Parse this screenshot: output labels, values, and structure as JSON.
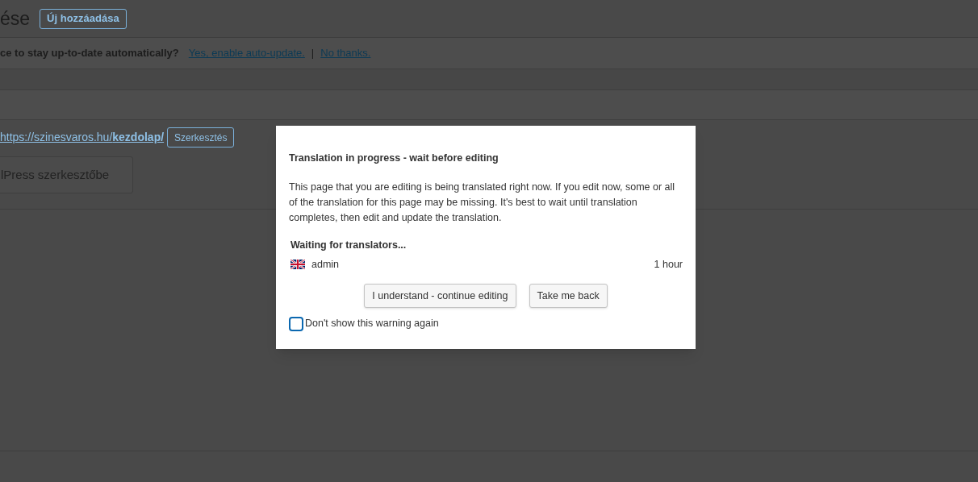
{
  "page": {
    "title": "ése",
    "add_new_button": "Új hozzáadása",
    "notice": {
      "text": "ce to stay up-to-date automatically?",
      "links": [
        "Yes, enable auto-update.",
        "No thanks."
      ],
      "separator": "|"
    },
    "permalink": {
      "url": "https://szinesvaros.hu/**kezdolap/**",
      "edit_button": "Szerkesztés"
    },
    "editor_button": "lPress szerkesztőbe"
  },
  "dialog": {
    "title": "Translation in progress - wait before editing",
    "message": "This page that you are editing is being translated right now. If you edit now, some or all of the translation for this page may be missing. It's best to wait until translation completes, then edit and update the translation.",
    "waiting_heading": "Waiting for translators...",
    "translators": [
      {
        "name": "admin",
        "time": "1 hour"
      }
    ],
    "buttons": [
      "I understand - continue editing",
      "Take me back"
    ],
    "checkbox": {
      "label": "Don't show this warning again",
      "checked": false
    }
  }
}
